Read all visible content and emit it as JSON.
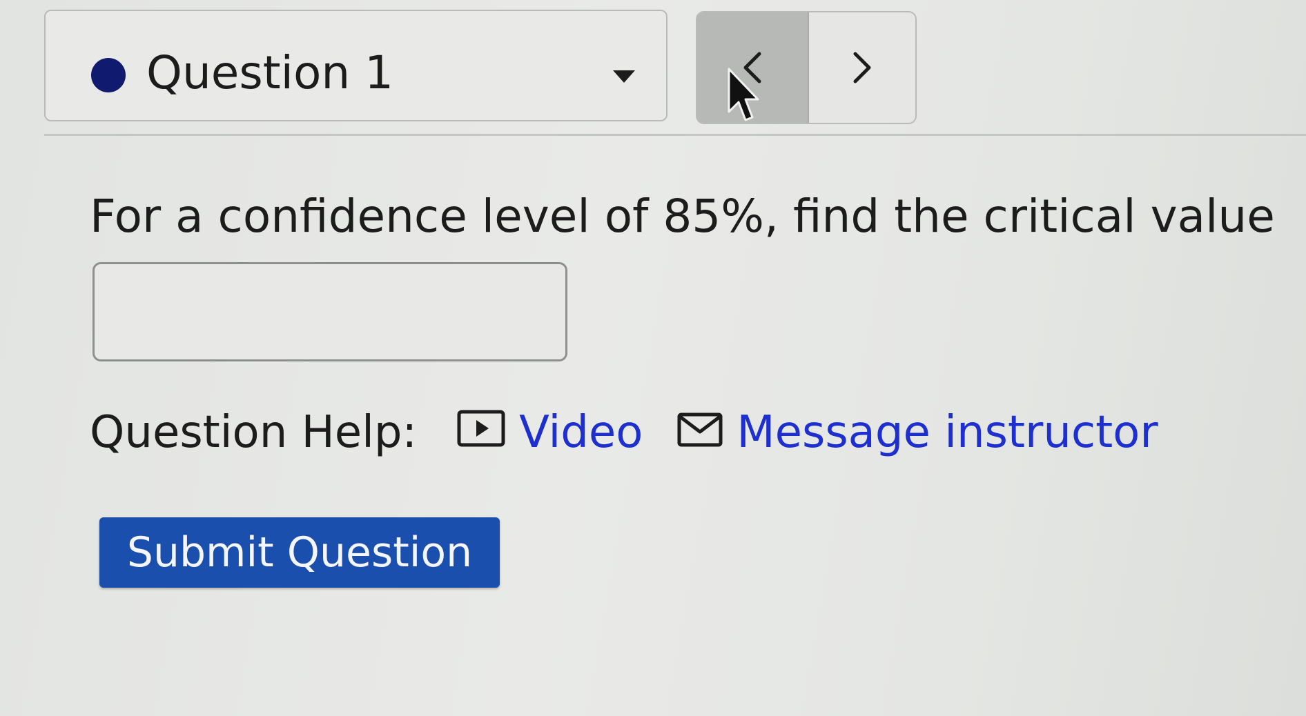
{
  "question_nav": {
    "current_question_label": "Question 1",
    "status_color": "#101a6e",
    "dropdown_icon": "caret-down-icon",
    "prev_icon": "chevron-left-icon",
    "next_icon": "chevron-right-icon"
  },
  "question": {
    "prompt": "For a confidence level of 85%, find the critical value",
    "answer_value": "",
    "answer_placeholder": ""
  },
  "help": {
    "label": "Question Help:",
    "video_label": "Video",
    "video_icon": "video-play-icon",
    "message_label": "Message instructor",
    "message_icon": "envelope-icon",
    "link_color": "#1e2fd0"
  },
  "actions": {
    "submit_label": "Submit Question",
    "submit_color": "#1a4fae"
  }
}
